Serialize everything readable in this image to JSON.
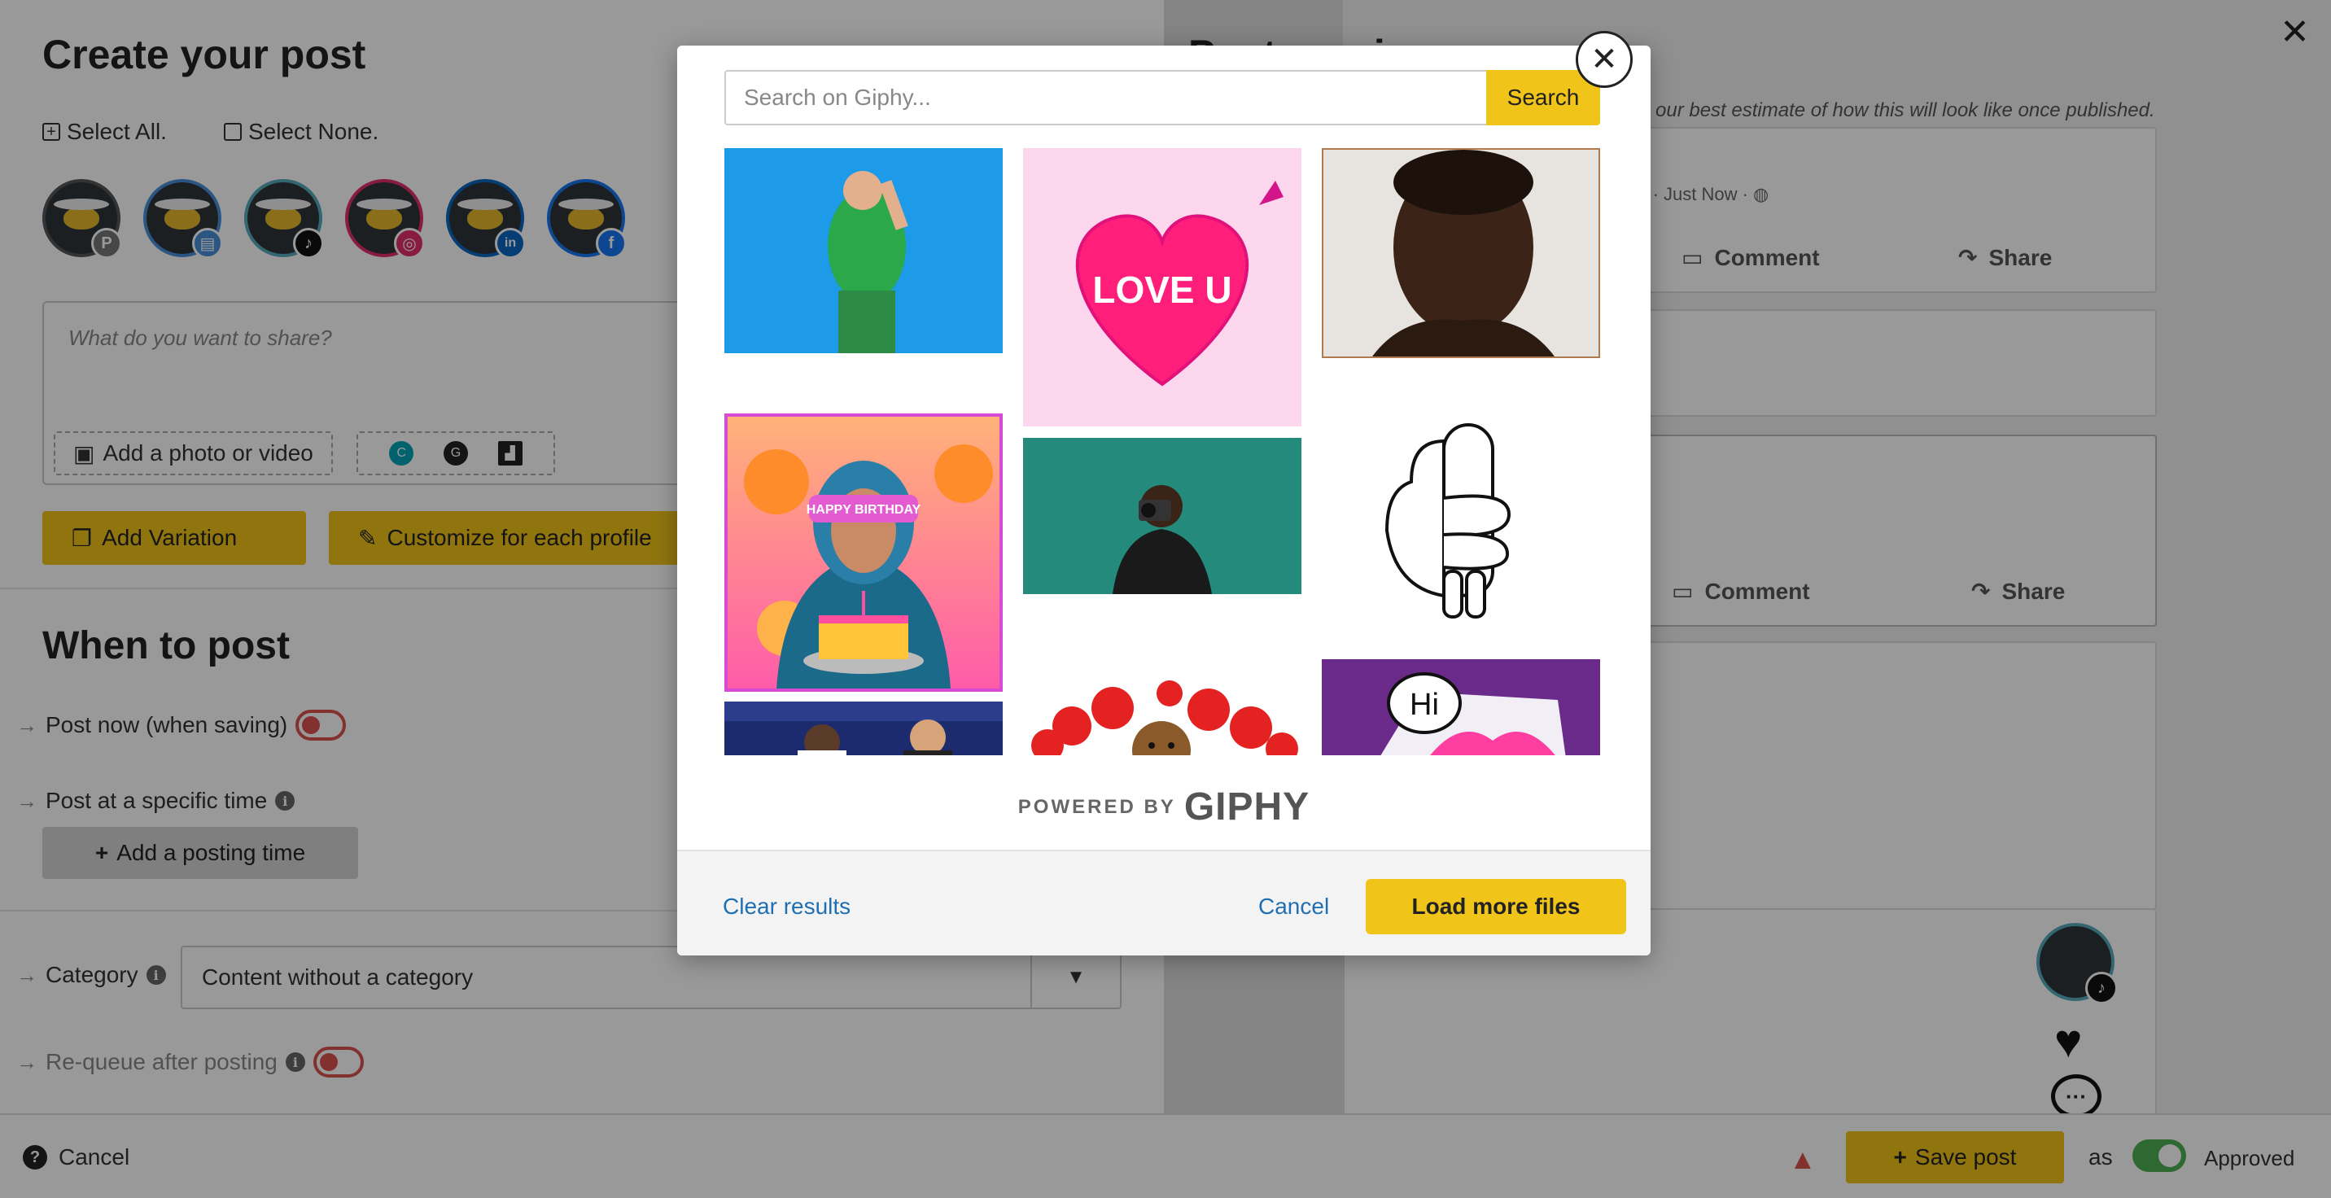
{
  "editor": {
    "title": "Create your post",
    "select_all": "Select All.",
    "select_none": "Select None.",
    "profiles": [
      {
        "network": "pinterest",
        "glyph": "P",
        "color": "#777777"
      },
      {
        "network": "gmb",
        "glyph": "▤",
        "color": "#4a90d9"
      },
      {
        "network": "tiktok",
        "glyph": "♪",
        "color": "#111111"
      },
      {
        "network": "instagram",
        "glyph": "◎",
        "color": "#e1306c"
      },
      {
        "network": "linkedin",
        "glyph": "in",
        "color": "#0a66c2"
      },
      {
        "network": "facebook",
        "glyph": "f",
        "color": "#1877f2"
      }
    ],
    "share_placeholder": "What do you want to share?",
    "add_photo": "Add a photo or video",
    "add_variation": "Add Variation",
    "customize": "Customize for each profile"
  },
  "schedule": {
    "title": "When to post",
    "post_now": "Post now (when saving)",
    "post_specific": "Post at a specific time",
    "add_time": "Add a posting time",
    "category_label": "Category",
    "category_value": "Content without a category",
    "requeue": "Re-queue after posting"
  },
  "preview": {
    "title": "Post preview",
    "note": "is our best estimate of how this will look like once published.",
    "meta": "[?] · Just Now ·",
    "comment": "Comment",
    "share": "Share"
  },
  "bottom_bar": {
    "cancel": "Cancel",
    "save": "Save post",
    "as": "as",
    "approved": "Approved"
  },
  "giphy_modal": {
    "search_placeholder": "Search on Giphy...",
    "search_button": "Search",
    "powered_small": "POWERED BY",
    "powered_brand": "GIPHY",
    "clear_results": "Clear results",
    "cancel": "Cancel",
    "load_more": "Load more files",
    "results": [
      {
        "name": "gif-wrestler-wave"
      },
      {
        "name": "gif-love-u-heart",
        "caption": "LOVE U"
      },
      {
        "name": "gif-boy-look"
      },
      {
        "name": "gif-happy-birthday",
        "caption": "HAPPY BIRTHDAY"
      },
      {
        "name": "gif-photographer"
      },
      {
        "name": "gif-hug-sticker"
      },
      {
        "name": "gif-volleyball"
      },
      {
        "name": "gif-bear-hearts"
      },
      {
        "name": "gif-hi-card",
        "caption": "Hi"
      }
    ]
  },
  "colors": {
    "accent_yellow": "#f0c419",
    "link_blue": "#1f6fb2",
    "toggle_off": "#d9534f",
    "toggle_on": "#4caf50"
  }
}
